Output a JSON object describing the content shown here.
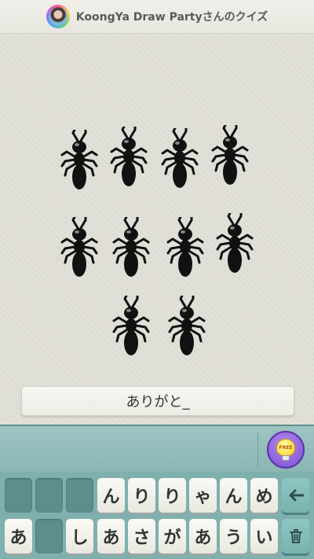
{
  "header": {
    "title": "KoongYa Draw Partyさんのクイズ"
  },
  "drawing": {
    "subject": "ants",
    "count": 10,
    "ink_color": "#111111"
  },
  "answer": {
    "text": "ありがと_"
  },
  "hint": {
    "label": "FREE"
  },
  "keyboard": {
    "row1": [
      "",
      "",
      "",
      "ん",
      "り",
      "り",
      "ゃ",
      "ん",
      "め"
    ],
    "row2": [
      "あ",
      "",
      "し",
      "あ",
      "さ",
      "が",
      "あ",
      "う",
      "い"
    ],
    "backspace_icon": "back-arrow-icon",
    "delete_icon": "trash-icon"
  },
  "colors": {
    "accent": "#7a4bd0",
    "keyboard_bg": "#7fb0ae",
    "hint_bulb": "#ffd21a"
  }
}
